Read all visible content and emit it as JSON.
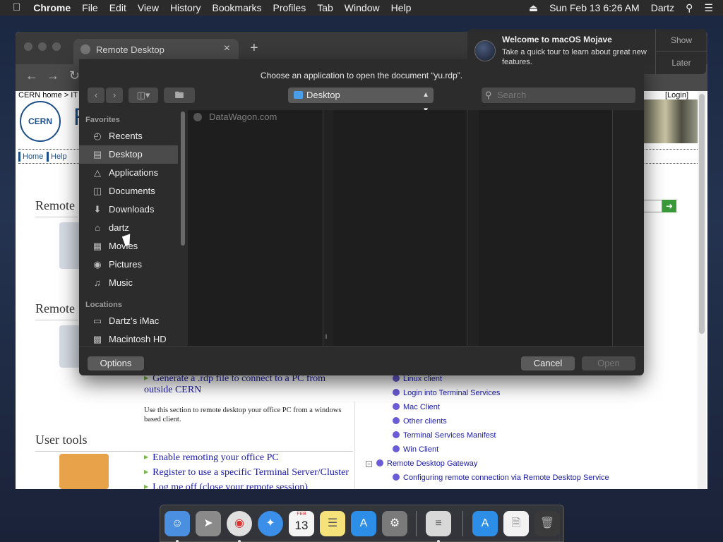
{
  "menubar": {
    "app": "Chrome",
    "items": [
      "File",
      "Edit",
      "View",
      "History",
      "Bookmarks",
      "Profiles",
      "Tab",
      "Window",
      "Help"
    ],
    "clock": "Sun Feb 13  6:26 AM",
    "user": "Dartz"
  },
  "browser": {
    "tab_title": "Remote Desktop",
    "breadcrumb": "CERN home > IT",
    "login": "[Login]",
    "logo_text": "CERN",
    "title_fragment": "R",
    "nav_home": "Home",
    "nav_help": "Help",
    "section_remote_1": "Remote",
    "section_remote_2": "Remote",
    "section_user_tools": "User tools",
    "link_generate": "Generate a .rdp file to connect to a PC from outside CERN",
    "desc_generate": "Use this section to remote desktop your office PC from a windows based client.",
    "links_user_tools": [
      "Enable remoting your office PC",
      "Register to use a specific Terminal Server/Cluster",
      "Log me off (close your remote session)"
    ],
    "tree_items": [
      "Linux client",
      "Login into Terminal Services",
      "Mac Client",
      "Other clients",
      "Terminal Services Manifest",
      "Win Client"
    ],
    "tree_parent": "Remote Desktop Gateway",
    "tree_child": "Configuring remote connection via Remote Desktop Service",
    "edge_fragment": "m"
  },
  "dialog": {
    "title": "Choose an application to open the document “yu.rdp”.",
    "location": "Desktop",
    "search_placeholder": "Search",
    "favorites_label": "Favorites",
    "locations_label": "Locations",
    "favorites": [
      {
        "label": "Recents",
        "icon": "clock-icon",
        "selected": false
      },
      {
        "label": "Desktop",
        "icon": "desktop-icon",
        "selected": true
      },
      {
        "label": "Applications",
        "icon": "applications-icon",
        "selected": false
      },
      {
        "label": "Documents",
        "icon": "document-icon",
        "selected": false
      },
      {
        "label": "Downloads",
        "icon": "download-icon",
        "selected": false
      },
      {
        "label": "dartz",
        "icon": "home-icon",
        "selected": false
      },
      {
        "label": "Movies",
        "icon": "film-icon",
        "selected": false
      },
      {
        "label": "Pictures",
        "icon": "camera-icon",
        "selected": false
      },
      {
        "label": "Music",
        "icon": "music-icon",
        "selected": false
      }
    ],
    "locations": [
      {
        "label": "Dartz’s iMac",
        "icon": "imac-icon"
      },
      {
        "label": "Macintosh HD",
        "icon": "disk-icon"
      }
    ],
    "file_item": "DataWagon.com",
    "options_label": "Options",
    "cancel_label": "Cancel",
    "open_label": "Open"
  },
  "notification": {
    "title": "Welcome to macOS Mojave",
    "body": "Take a quick tour to learn about great new features.",
    "show_label": "Show",
    "later_label": "Later"
  },
  "dock": {
    "calendar_day": "13",
    "calendar_month": "FEB"
  },
  "colors": {
    "accent_blue": "#1a1aa6",
    "cern_blue": "#1c4f8a",
    "bullet_green": "#7ab648",
    "dialog_bg": "#2c2c2c",
    "selected_row": "#4b4b4b"
  }
}
